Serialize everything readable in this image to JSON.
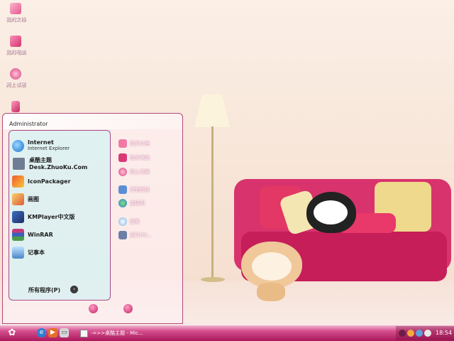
{
  "desktop_icons": [
    {
      "label": "我的文档",
      "icon": "folder-icon"
    },
    {
      "label": "我的电脑",
      "icon": "computer-icon"
    },
    {
      "label": "网上邻居",
      "icon": "network-icon"
    }
  ],
  "start_menu": {
    "user_name": "Administrator",
    "pinned": [
      {
        "title": "Internet",
        "subtitle": "Internet Explorer",
        "icon": "internet-explorer-icon"
      },
      {
        "title": "桌酷主题Desk.ZhuoKu.Com",
        "icon": "zhuoku-icon"
      },
      {
        "title": "IconPackager",
        "icon": "iconpackager-icon"
      },
      {
        "title": "画图",
        "icon": "paint-icon"
      },
      {
        "title": "KMPlayer中文版",
        "icon": "kmplayer-icon"
      },
      {
        "title": "WinRAR",
        "icon": "winrar-icon"
      },
      {
        "title": "记事本",
        "icon": "notepad-icon"
      }
    ],
    "all_programs": "所有程序(P)",
    "right_items": [
      {
        "label": "我的文档",
        "icon": "documents-icon"
      },
      {
        "label": "我的电脑",
        "icon": "computer-icon"
      },
      {
        "label": "网上邻居",
        "icon": "network-icon"
      },
      {
        "label": "控制面板",
        "icon": "control-panel-icon"
      },
      {
        "label": "连接到",
        "icon": "connect-icon"
      },
      {
        "label": "搜索",
        "icon": "search-icon"
      },
      {
        "label": "运行(R)...",
        "icon": "run-icon"
      }
    ]
  },
  "taskbar": {
    "task_label": "-=>>桌酷主题 - Mic...",
    "clock": "18:54"
  },
  "colors": {
    "accent": "#c51e59",
    "taskbar": "#a9185a"
  }
}
